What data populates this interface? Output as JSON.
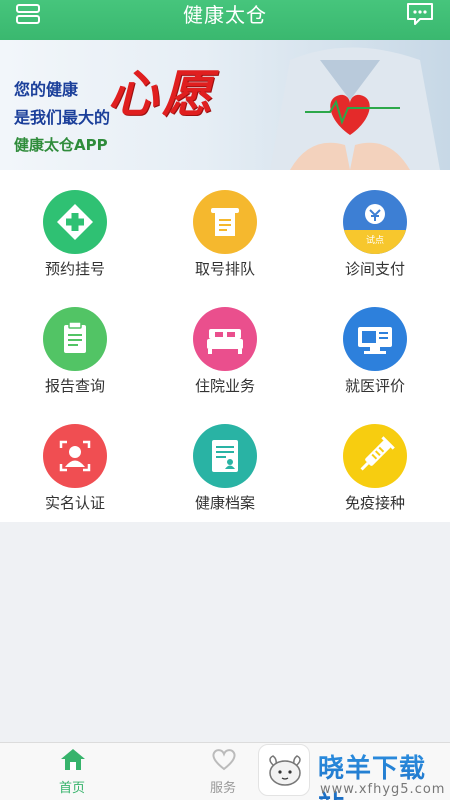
{
  "header": {
    "title": "健康太仓"
  },
  "banner": {
    "line1": "您的健康",
    "line2": "是我们最大的",
    "line3": "健康太仓APP",
    "big_word": "心愿"
  },
  "services": [
    {
      "label": "预约挂号",
      "icon": "appointment-icon",
      "color": "#2fc173"
    },
    {
      "label": "取号排队",
      "icon": "ticket-queue-icon",
      "color": "#f5b82e"
    },
    {
      "label": "诊间支付",
      "icon": "payment-icon",
      "color": "#3d7fd4",
      "badge": "试点"
    },
    {
      "label": "报告查询",
      "icon": "report-icon",
      "color": "#52c465"
    },
    {
      "label": "住院业务",
      "icon": "hospital-bed-icon",
      "color": "#ea4f8d"
    },
    {
      "label": "就医评价",
      "icon": "evaluation-icon",
      "color": "#2d80dc"
    },
    {
      "label": "实名认证",
      "icon": "id-verify-icon",
      "color": "#f04e52"
    },
    {
      "label": "健康档案",
      "icon": "health-record-icon",
      "color": "#29b3a4"
    },
    {
      "label": "免疫接种",
      "icon": "vaccine-icon",
      "color": "#f7cd10"
    }
  ],
  "tabbar": {
    "home": "首页",
    "service": "服务",
    "active_color": "#36b36b",
    "inactive_color": "#999999"
  },
  "watermark": {
    "title": "晓羊下载站",
    "url": "www.xfhyg5.com"
  }
}
